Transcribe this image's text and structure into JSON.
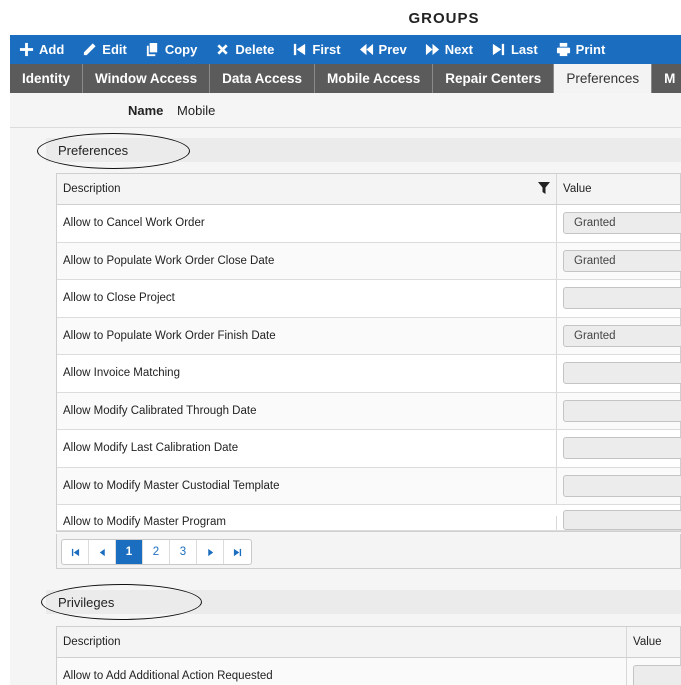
{
  "page": {
    "title": "GROUPS"
  },
  "toolbar": {
    "buttons": [
      {
        "label": "Add",
        "icon": "plus-icon"
      },
      {
        "label": "Edit",
        "icon": "pencil-icon"
      },
      {
        "label": "Copy",
        "icon": "copy-icon"
      },
      {
        "label": "Delete",
        "icon": "x-icon"
      },
      {
        "label": "First",
        "icon": "first-icon"
      },
      {
        "label": "Prev",
        "icon": "prev-icon"
      },
      {
        "label": "Next",
        "icon": "next-icon"
      },
      {
        "label": "Last",
        "icon": "last-icon"
      },
      {
        "label": "Print",
        "icon": "printer-icon"
      }
    ],
    "color": "#1b6dbf"
  },
  "tabs": [
    {
      "label": "Identity"
    },
    {
      "label": "Window Access"
    },
    {
      "label": "Data Access"
    },
    {
      "label": "Mobile Access"
    },
    {
      "label": "Repair Centers"
    },
    {
      "label": "Preferences",
      "active": true
    },
    {
      "label": "M"
    }
  ],
  "name_field": {
    "label": "Name",
    "value": "Mobile"
  },
  "preferences": {
    "section_title": "Preferences",
    "columns": {
      "description": "Description",
      "value": "Value"
    },
    "rows": [
      {
        "description": "Allow to Cancel Work Order",
        "value": "Granted"
      },
      {
        "description": "Allow to Populate Work Order Close Date",
        "value": "Granted"
      },
      {
        "description": "Allow to Close Project",
        "value": ""
      },
      {
        "description": "Allow to Populate Work Order Finish Date",
        "value": "Granted"
      },
      {
        "description": "Allow Invoice Matching",
        "value": ""
      },
      {
        "description": "Allow Modify Calibrated Through Date",
        "value": ""
      },
      {
        "description": "Allow Modify Last Calibration Date",
        "value": ""
      },
      {
        "description": "Allow to Modify Master Custodial Template",
        "value": ""
      },
      {
        "description": "Allow to Modify Master Program",
        "value": ""
      }
    ],
    "pager": {
      "pages": [
        "1",
        "2",
        "3"
      ],
      "current": "1"
    }
  },
  "privileges": {
    "section_title": "Privileges",
    "columns": {
      "description": "Description",
      "value": "Value"
    },
    "rows": [
      {
        "description": "Allow to Add Additional Action Requested",
        "value": ""
      }
    ]
  }
}
